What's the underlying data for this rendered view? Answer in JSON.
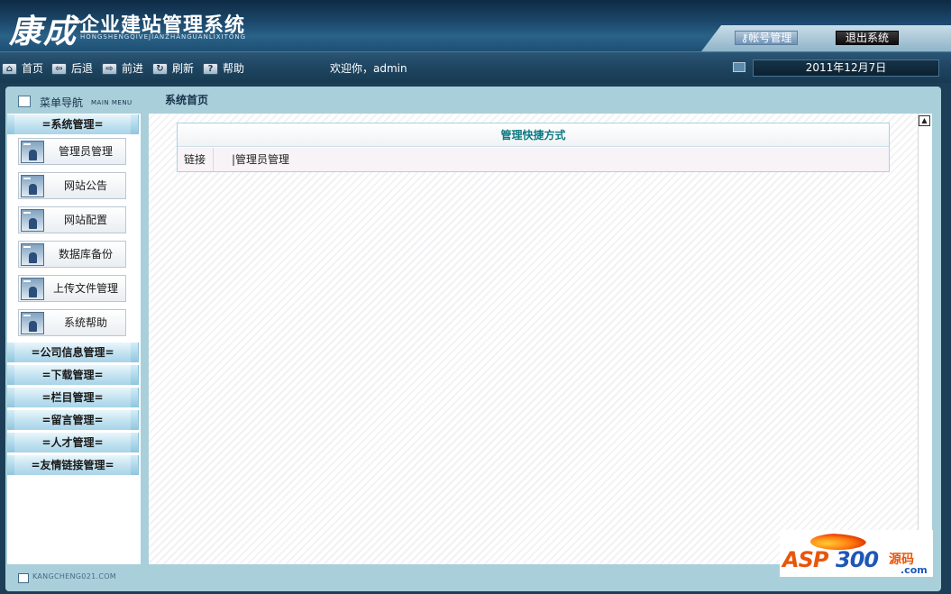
{
  "header": {
    "logo_big": "康成",
    "logo_title": "企业建站管理系统",
    "logo_pinyin": "HONGSHENGQIVEJIANZHANGUANLIXITONG",
    "account_label": "帐号管理",
    "logout_label": "退出系统"
  },
  "toolbar": {
    "home": "首页",
    "back": "后退",
    "forward": "前进",
    "refresh": "刷新",
    "help": "帮助",
    "welcome": "欢迎你，admin",
    "date": "2011年12月7日"
  },
  "sidebar": {
    "title": "菜单导航",
    "title_en": "MAIN MENU",
    "groups": [
      {
        "label": "=系统管理="
      },
      {
        "label": "=公司信息管理="
      },
      {
        "label": "=下载管理="
      },
      {
        "label": "=栏目管理="
      },
      {
        "label": "=留言管理="
      },
      {
        "label": "=人才管理="
      },
      {
        "label": "=友情链接管理="
      }
    ],
    "items": [
      {
        "label": "管理员管理"
      },
      {
        "label": "网站公告"
      },
      {
        "label": "网站配置"
      },
      {
        "label": "数据库备份"
      },
      {
        "label": "上传文件管理"
      },
      {
        "label": "系统帮助"
      }
    ]
  },
  "main": {
    "page_title": "系统首页",
    "table_title": "管理快捷方式",
    "row_label": "链接",
    "row_link": "|管理员管理"
  },
  "footer": {
    "text": "KANGCHENG021.COM"
  },
  "watermark": {
    "asp": "ASP",
    "num": "300",
    "yuan": "源码",
    "com": ".com"
  }
}
